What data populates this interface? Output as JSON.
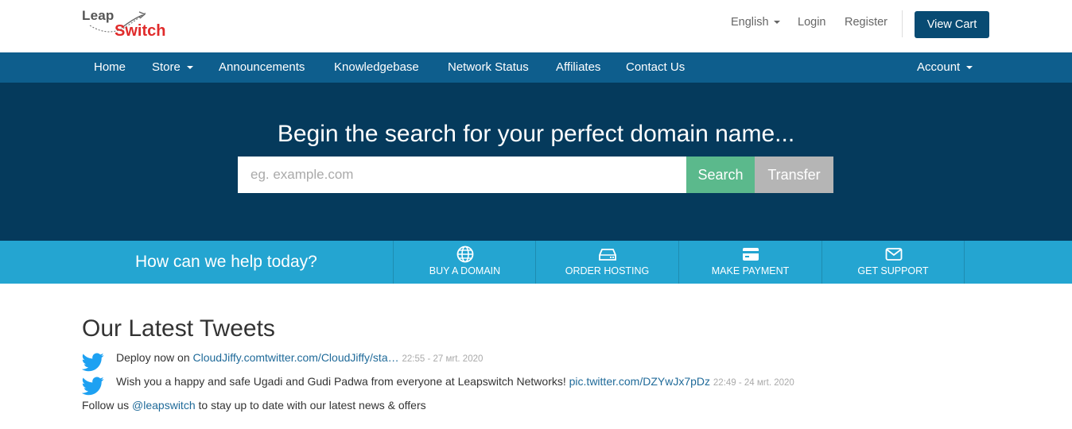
{
  "header": {
    "logo_top": "Leap",
    "logo_bottom": "Switch",
    "language": "English",
    "login": "Login",
    "register": "Register",
    "view_cart": "View Cart"
  },
  "nav": {
    "home": "Home",
    "store": "Store",
    "announcements": "Announcements",
    "knowledgebase": "Knowledgebase",
    "network_status": "Network Status",
    "affiliates": "Affiliates",
    "contact_us": "Contact Us",
    "account": "Account"
  },
  "hero": {
    "title": "Begin the search for your perfect domain name...",
    "placeholder": "eg. example.com",
    "search_button": "Search",
    "transfer_button": "Transfer"
  },
  "help": {
    "prompt": "How can we help today?",
    "actions": [
      {
        "label": "Buy a Domain",
        "icon": "globe-icon"
      },
      {
        "label": "Order Hosting",
        "icon": "server-icon"
      },
      {
        "label": "Make Payment",
        "icon": "credit-card-icon"
      },
      {
        "label": "Get Support",
        "icon": "envelope-icon"
      }
    ]
  },
  "tweets": {
    "title": "Our Latest Tweets",
    "items": [
      {
        "prefix": "Deploy now on ",
        "link": "CloudJiffy.comtwitter.com/CloudJiffy/sta…",
        "date": "22:55 - 27 мrt. 2020"
      },
      {
        "prefix": "Wish you a happy and safe Ugadi and Gudi Padwa from everyone at Leapswitch Networks! ",
        "link": "pic.twitter.com/DZYwJx7pDz",
        "date": "22:49 - 24 мrt. 2020"
      }
    ],
    "follow_prefix": "Follow us ",
    "follow_handle": "@leapswitch",
    "follow_suffix": " to stay up to date with our latest news & offers"
  },
  "colors": {
    "brand_dark": "#053a5c",
    "nav": "#0e5e8d",
    "accent": "#24a5d1",
    "search_green": "#5bb98c",
    "logo_red": "#e02b2b"
  }
}
